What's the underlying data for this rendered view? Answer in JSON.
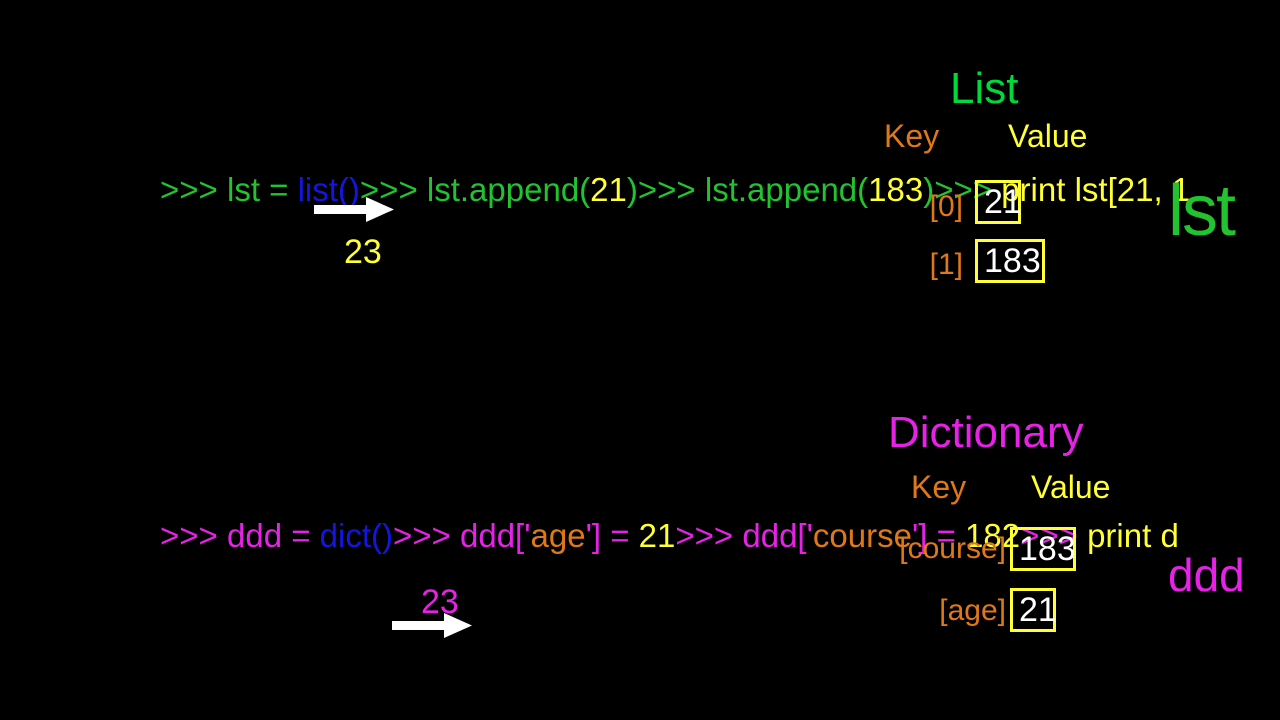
{
  "slide": {
    "background_color": "#000000",
    "colors": {
      "green": "#22c32e",
      "bright_green": "#00d93a",
      "blue": "#1515e0",
      "yellow": "#ffff33",
      "magenta": "#e622e6",
      "orange": "#e07818",
      "white": "#ffffff"
    }
  },
  "list_section": {
    "title": "List",
    "header_key": "Key",
    "header_value": "Value",
    "code_segments": [
      {
        "text": ">>> lst = ",
        "color": "green"
      },
      {
        "text": "list()",
        "color": "blue"
      },
      {
        "text": ">>> lst.append(",
        "color": "green"
      },
      {
        "text": "21",
        "color": "yellow"
      },
      {
        "text": ")",
        "color": "green"
      },
      {
        "text": ">>> lst.append(",
        "color": "green"
      },
      {
        "text": "183",
        "color": "yellow"
      },
      {
        "text": ")",
        "color": "green"
      },
      {
        "text": ">>> ",
        "color": "green"
      },
      {
        "text": "print lst",
        "color": "yellow"
      },
      {
        "text": "[21, 1",
        "color": "yellow"
      }
    ],
    "code_plain": ">>> lst = list()>>> lst.append(21)>>> lst.append(183)>>> print lst[21, 1",
    "overlay_word": "lst",
    "annotation_number": "23",
    "rows": [
      {
        "key": "[0]",
        "value": "21"
      },
      {
        "key": "[1]",
        "value": "183"
      }
    ]
  },
  "dict_section": {
    "title": "Dictionary",
    "header_key": "Key",
    "header_value": "Value",
    "code_segments": [
      {
        "text": ">>> ddd = ",
        "color": "magenta"
      },
      {
        "text": "dict()",
        "color": "blue"
      },
      {
        "text": ">>> ddd['",
        "color": "magenta"
      },
      {
        "text": "age",
        "color": "orange"
      },
      {
        "text": "'] = ",
        "color": "magenta"
      },
      {
        "text": "21",
        "color": "yellow"
      },
      {
        "text": ">>> ddd['",
        "color": "magenta"
      },
      {
        "text": "course",
        "color": "orange"
      },
      {
        "text": "'] = ",
        "color": "magenta"
      },
      {
        "text": "182",
        "color": "yellow"
      },
      {
        "text": ">>> ",
        "color": "magenta"
      },
      {
        "text": "print d",
        "color": "yellow"
      }
    ],
    "code_plain": ">>> ddd = dict()>>> ddd['age'] = 21>>> ddd['course'] = 182>>> print d",
    "overlay_word": "ddd",
    "annotation_number": "23",
    "rows": [
      {
        "key": "[course]",
        "value": "183"
      },
      {
        "key": "[age]",
        "value": "21"
      }
    ]
  },
  "icons": {
    "arrow_right": "arrow-right-icon"
  }
}
